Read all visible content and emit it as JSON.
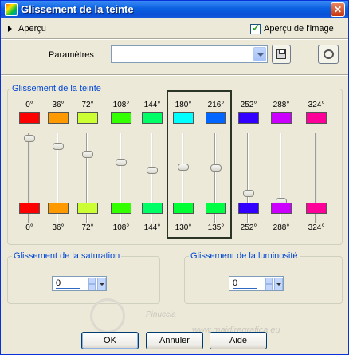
{
  "window": {
    "title": "Glissement de la teinte",
    "close_label": "✕"
  },
  "preview": {
    "label": "Aperçu",
    "checkbox_label": "Aperçu de l'image",
    "checked": true,
    "checkmark": "✓"
  },
  "params": {
    "label": "Paramètres",
    "value": ""
  },
  "hue": {
    "group_label": "Glissement de la teinte",
    "columns": [
      {
        "top": "0°",
        "bottom": "0°",
        "top_color": "#ff0000",
        "bottom_color": "#ff0000",
        "level": 0.0
      },
      {
        "top": "36°",
        "bottom": "36°",
        "top_color": "#ff9900",
        "bottom_color": "#ff9900",
        "level": 0.1
      },
      {
        "top": "72°",
        "bottom": "72°",
        "top_color": "#ccff33",
        "bottom_color": "#ccff33",
        "level": 0.2
      },
      {
        "top": "108°",
        "bottom": "108°",
        "top_color": "#33ff00",
        "bottom_color": "#33ff00",
        "level": 0.3
      },
      {
        "top": "144°",
        "bottom": "144°",
        "top_color": "#00ff66",
        "bottom_color": "#00ff66",
        "level": 0.4
      },
      {
        "top": "180°",
        "bottom": "130°",
        "top_color": "#00ffff",
        "bottom_color": "#00ff33",
        "level": 0.36
      },
      {
        "top": "216°",
        "bottom": "135°",
        "top_color": "#0066ff",
        "bottom_color": "#00ff44",
        "level": 0.375
      },
      {
        "top": "252°",
        "bottom": "252°",
        "top_color": "#3300ff",
        "bottom_color": "#3300ff",
        "level": 0.7
      },
      {
        "top": "288°",
        "bottom": "288°",
        "top_color": "#cc00ff",
        "bottom_color": "#cc00ff",
        "level": 0.8
      },
      {
        "top": "324°",
        "bottom": "324°",
        "top_color": "#ff0099",
        "bottom_color": "#ff0099",
        "level": 0.9
      }
    ]
  },
  "saturation": {
    "group_label": "Glissement de la saturation",
    "value": "0"
  },
  "luminosity": {
    "group_label": "Glissement de la luminosité",
    "value": "0"
  },
  "buttons": {
    "ok": "OK",
    "cancel": "Annuler",
    "help": "Aide"
  },
  "watermark": {
    "line1": "Pinuccia",
    "line2": "www.maidiregrafica.eu"
  }
}
